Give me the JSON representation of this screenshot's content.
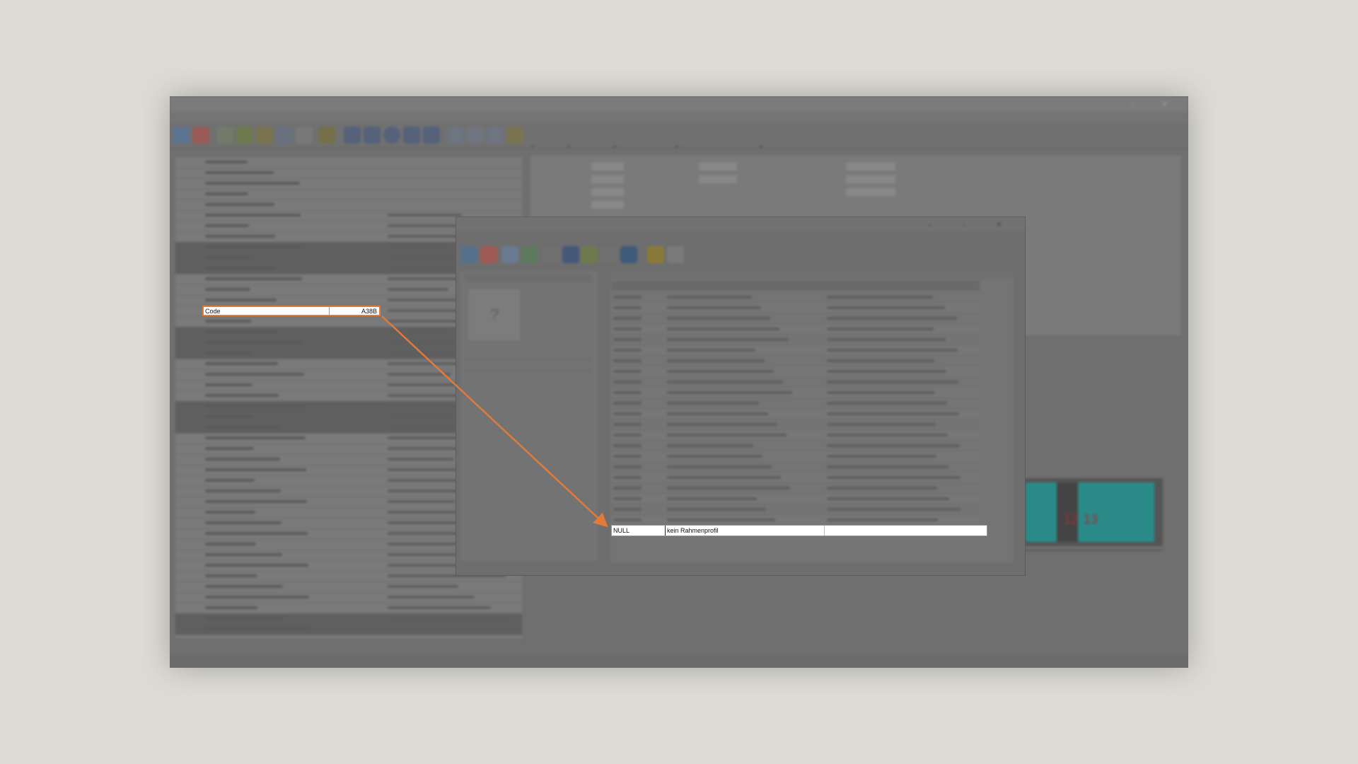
{
  "highlight": {
    "code_label": "Code",
    "code_value": "A38B",
    "null_code": "NULL",
    "null_description": "kein Rahmenprofil"
  },
  "colors": {
    "accent": "#e07b3a",
    "background": "#dcdcd4",
    "teal": "#2fb8b4"
  }
}
